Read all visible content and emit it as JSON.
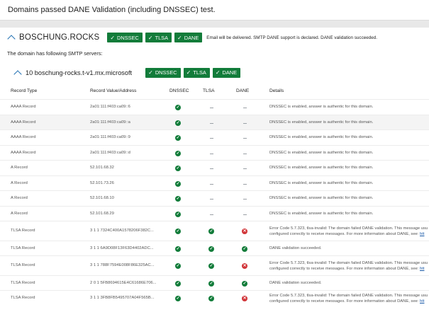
{
  "header": {
    "title": "Domains passed DANE Validation (including DNSSEC) test."
  },
  "domain": {
    "name": "BOSCHUNG.ROCKS",
    "badges": [
      "DNSSEC",
      "TLSA",
      "DANE"
    ],
    "message": "Email will be delivered. SMTP DANE support is declared. DANE validation succeeded."
  },
  "servers_label": "The domain has following SMTP servers:",
  "mx": {
    "name": "10 boschung-rocks.t-v1.mx.microsoft",
    "badges": [
      "DNSSEC",
      "TLSA",
      "DANE"
    ]
  },
  "columns": {
    "record_type": "Record Type",
    "record_value": "Record Value/Address",
    "dnssec": "DNSSEC",
    "tlsa": "TLSA",
    "dane": "DANE",
    "details": "Details"
  },
  "status_icons": {
    "pass": "check-circle-icon",
    "fail": "error-circle-icon",
    "none": "dash-icon"
  },
  "colors": {
    "pass": "#127c3a",
    "fail": "#d13438",
    "link": "#1a5aa8"
  },
  "rows": [
    {
      "type": "AAAA Record",
      "value": "2a01:111:f403:ca09::6",
      "dnssec": "pass",
      "tlsa": "none",
      "dane": "none",
      "details": "DNSSEC is enabled, answer is authentic for this domain.",
      "details2": "",
      "link": ""
    },
    {
      "type": "AAAA Record",
      "value": "2a01:111:f403:ca09::a",
      "dnssec": "pass",
      "tlsa": "none",
      "dane": "none",
      "details": "DNSSEC is enabled, answer is authentic for this domain.",
      "details2": "",
      "link": ""
    },
    {
      "type": "AAAA Record",
      "value": "2a01:111:f403:ca09::9",
      "dnssec": "pass",
      "tlsa": "none",
      "dane": "none",
      "details": "DNSSEC is enabled, answer is authentic for this domain.",
      "details2": "",
      "link": ""
    },
    {
      "type": "AAAA Record",
      "value": "2a01:111:f403:ca09::d",
      "dnssec": "pass",
      "tlsa": "none",
      "dane": "none",
      "details": "DNSSEC is enabled, answer is authentic for this domain.",
      "details2": "",
      "link": ""
    },
    {
      "type": "A Record",
      "value": "52.101.68.32",
      "dnssec": "pass",
      "tlsa": "none",
      "dane": "none",
      "details": "DNSSEC is enabled, answer is authentic for this domain.",
      "details2": "",
      "link": ""
    },
    {
      "type": "A Record",
      "value": "52.101.73.26",
      "dnssec": "pass",
      "tlsa": "none",
      "dane": "none",
      "details": "DNSSEC is enabled, answer is authentic for this domain.",
      "details2": "",
      "link": ""
    },
    {
      "type": "A Record",
      "value": "52.101.68.10",
      "dnssec": "pass",
      "tlsa": "none",
      "dane": "none",
      "details": "DNSSEC is enabled, answer is authentic for this domain.",
      "details2": "",
      "link": ""
    },
    {
      "type": "A Record",
      "value": "52.101.68.29",
      "dnssec": "pass",
      "tlsa": "none",
      "dane": "none",
      "details": "DNSSEC is enabled, answer is authentic for this domain.",
      "details2": "",
      "link": ""
    },
    {
      "type": "TLSA Record",
      "value": "3 1 1 7324C400A1578206F382C...",
      "dnssec": "pass",
      "tlsa": "pass",
      "dane": "fail",
      "details": "Error Code 5.7.323, tlsa-invalid: The domain failed DANE validation. This message usu",
      "details2": "configured correctly to receive messages. For more information about DANE, see: ",
      "link": "htt"
    },
    {
      "type": "TLSA Record",
      "value": "3 1 1 6A9D08F13F63D4402ADC...",
      "dnssec": "pass",
      "tlsa": "pass",
      "dane": "pass",
      "details": "DANE validation succeeded.",
      "details2": "",
      "link": ""
    },
    {
      "type": "TLSA Record",
      "value": "3 1 1 788F7594E008F86E325AC...",
      "dnssec": "pass",
      "tlsa": "pass",
      "dane": "fail",
      "details": "Error Code 5.7.323, tlsa-invalid: The domain failed DANE validation. This message usu",
      "details2": "configured correctly to receive messages. For more information about DANE, see: ",
      "link": "htt"
    },
    {
      "type": "TLSA Record",
      "value": "2 0 1 5FB8694615E4C61686E706...",
      "dnssec": "pass",
      "tlsa": "pass",
      "dane": "pass",
      "details": "DANE validation succeeded.",
      "details2": "",
      "link": ""
    },
    {
      "type": "TLSA Record",
      "value": "3 1 1 3FB8FB5495707A04F565B...",
      "dnssec": "pass",
      "tlsa": "pass",
      "dane": "fail",
      "details": "Error Code 5.7.323, tlsa-invalid: The domain failed DANE validation. This message usu",
      "details2": "configured correctly to receive messages. For more information about DANE, see: ",
      "link": "htt"
    }
  ]
}
